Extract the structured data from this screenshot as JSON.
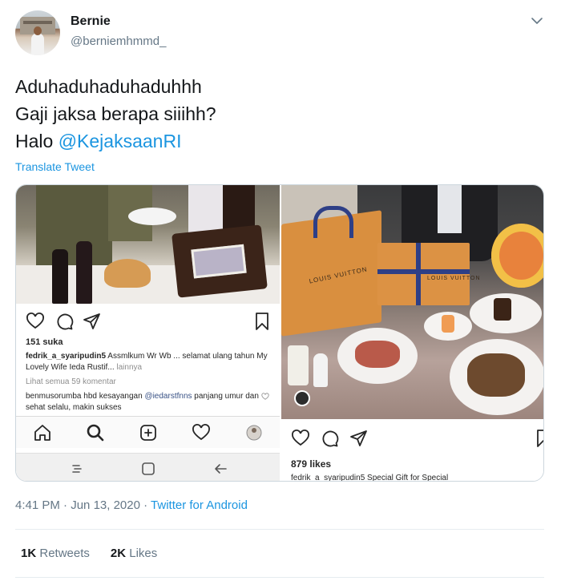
{
  "author": {
    "display_name": "Bernie",
    "handle": "@berniemhmmd_"
  },
  "tweet": {
    "line1": "Aduhaduhaduhaduhhh",
    "line2": "Gaji jaksa berapa siiihh?",
    "line3_prefix": "Halo ",
    "mention": "@KejaksaanRI",
    "translate_label": "Translate Tweet"
  },
  "media": {
    "left": {
      "likes": "151 suka",
      "caption_user": "fedrik_a_syaripudin5",
      "caption_text": " Assmlkum Wr Wb ... selamat ulang tahun My Lovely Wife Ieda Rustif...",
      "caption_more": " lainnya",
      "view_all": "Lihat semua 59 komentar",
      "comment_user": "benmusorumba",
      "comment_text": " hbd kesayangan ",
      "comment_tag": "@iedarstfnns",
      "comment_cont": " panjang umur dan sehat selalu, makin sukses"
    },
    "right": {
      "lv_text_bag": "LOUIS VUITTON",
      "lv_text_box": "LOUIS VUITTON",
      "likes": "879 likes",
      "caption": "fedrik_a_syaripudin5 Special Gift for Special"
    }
  },
  "footer": {
    "time": "4:41 PM",
    "sep1": " · ",
    "date": "Jun 13, 2020",
    "sep2": " · ",
    "source": "Twitter for Android",
    "retweets_count": "1K",
    "retweets_label": "Retweets",
    "likes_count": "2K",
    "likes_label": "Likes"
  },
  "colors": {
    "link": "#1b95e0",
    "muted": "#657786",
    "text": "#14171a"
  }
}
